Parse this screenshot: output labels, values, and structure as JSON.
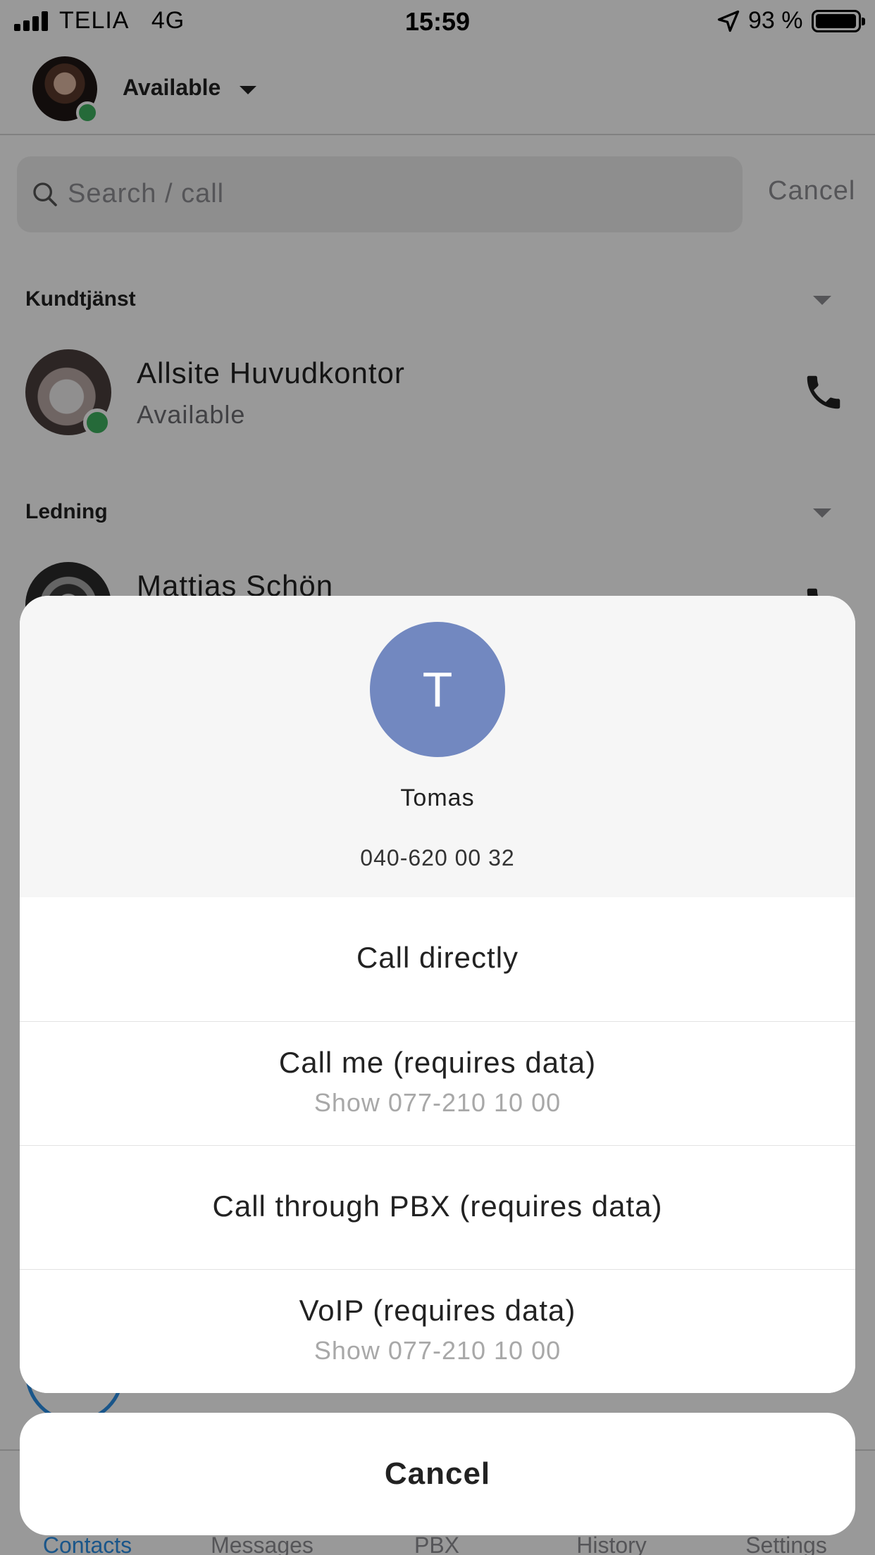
{
  "status_bar": {
    "carrier": "TELIA",
    "network": "4G",
    "time": "15:59",
    "battery": "93 %"
  },
  "profile": {
    "status": "Available",
    "presence_color": "#3fb15f"
  },
  "search": {
    "placeholder": "Search / call",
    "cancel_label": "Cancel"
  },
  "groups": [
    {
      "name": "Kundtjänst",
      "contacts": [
        {
          "name": "Allsite Huvudkontor",
          "status": "Available"
        }
      ]
    },
    {
      "name": "Ledning",
      "contacts": [
        {
          "name": "Mattias Schön",
          "status": ""
        }
      ]
    }
  ],
  "tabs": [
    {
      "label": "Contacts",
      "active": true
    },
    {
      "label": "Messages",
      "active": false
    },
    {
      "label": "PBX",
      "active": false
    },
    {
      "label": "History",
      "active": false
    },
    {
      "label": "Settings",
      "active": false
    }
  ],
  "accent_color": "#2c8fe6",
  "action_sheet": {
    "initial": "T",
    "name": "Tomas",
    "number": "040-620 00 32",
    "avatar_color": "#7288c0",
    "options": [
      {
        "label": "Call directly",
        "sub": ""
      },
      {
        "label": "Call me (requires data)",
        "sub": "Show 077-210 10 00"
      },
      {
        "label": "Call through PBX (requires data)",
        "sub": ""
      },
      {
        "label": "VoIP (requires data)",
        "sub": "Show 077-210 10 00"
      }
    ],
    "cancel_label": "Cancel"
  }
}
